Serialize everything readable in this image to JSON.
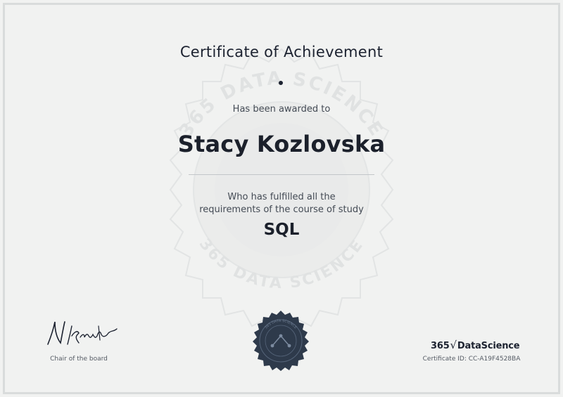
{
  "certificate": {
    "title": "Certificate of Achievement",
    "awarded_text": "Has been awarded to",
    "recipient_name": "Stacy Kozlovska",
    "fulfilled_line1": "Who has fulfilled all the",
    "fulfilled_line2": "requirements of the course of study",
    "course_name": "SQL"
  },
  "watermark": {
    "text": "365 DATA SCIENCE"
  },
  "signature": {
    "signer_text": "N.Krastev",
    "caption": "Chair of the board"
  },
  "brand": {
    "number": "365",
    "name": "DataScience",
    "certificate_id": "Certificate ID: CC-A19F4528BA"
  },
  "colors": {
    "background": "#f1f2f1",
    "border": "#d9dcdc",
    "text_dark": "#1c2230",
    "seal": "#2e3a4b"
  }
}
